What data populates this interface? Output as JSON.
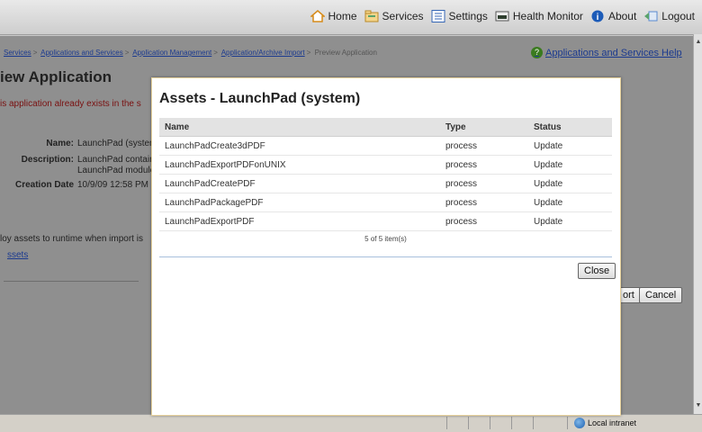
{
  "topnav": [
    {
      "label": "Home",
      "icon": "home-icon",
      "color": "#d68b1a"
    },
    {
      "label": "Services",
      "icon": "services-icon",
      "color": "#d9a94a"
    },
    {
      "label": "Settings",
      "icon": "settings-icon",
      "color": "#3566b5"
    },
    {
      "label": "Health Monitor",
      "icon": "health-monitor-icon",
      "color": "#2f7d3c"
    },
    {
      "label": "About",
      "icon": "info-icon",
      "color": "#1c5bb8"
    },
    {
      "label": "Logout",
      "icon": "logout-icon",
      "color": "#5a8ad0"
    }
  ],
  "breadcrumb": {
    "items": [
      "Services",
      "Applications and Services",
      "Application Management",
      "Application/Archive Import"
    ],
    "current": "Preview Application"
  },
  "help_link": "Applications and Services Help",
  "page_title": "iew Application",
  "warning": "is application already exists in the s",
  "fields": {
    "name_label": "Name:",
    "name_value": "LaunchPad (system",
    "desc_label": "Description:",
    "desc_value1": "LaunchPad contain",
    "desc_value2": "LaunchPad module",
    "created_label": "Creation Date",
    "created_value": "10/9/09 12:58 PM"
  },
  "deploy_text": "loy assets to runtime when import is",
  "assets_link": "ssets",
  "buttons": {
    "import": "ort",
    "cancel": "Cancel"
  },
  "status_zone": "Local intranet",
  "modal": {
    "title": "Assets - LaunchPad (system)",
    "columns": [
      "Name",
      "Type",
      "Status"
    ],
    "rows": [
      [
        "LaunchPadCreate3dPDF",
        "process",
        "Update"
      ],
      [
        "LaunchPadExportPDFonUNIX",
        "process",
        "Update"
      ],
      [
        "LaunchPadCreatePDF",
        "process",
        "Update"
      ],
      [
        "LaunchPadPackagePDF",
        "process",
        "Update"
      ],
      [
        "LaunchPadExportPDF",
        "process",
        "Update"
      ]
    ],
    "count": "5 of 5 item(s)",
    "close": "Close"
  }
}
